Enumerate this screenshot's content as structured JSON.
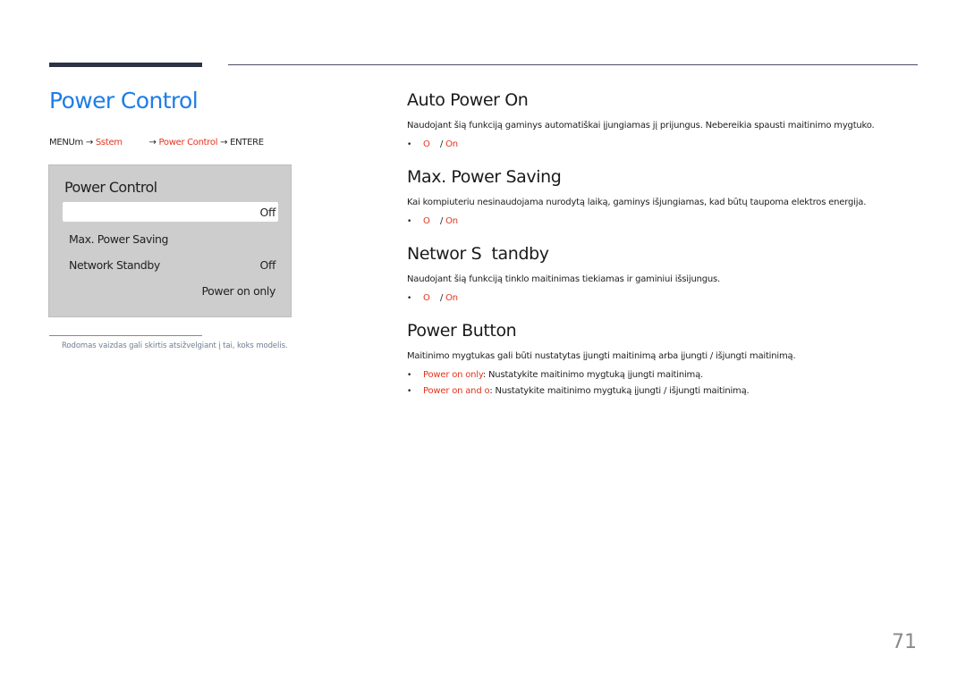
{
  "header": {
    "title": "Power Control",
    "breadcrumb": {
      "menu": "MENUm",
      "arrow": "→",
      "system": "Sstem",
      "section": "Power Control",
      "enter": "ENTERE"
    }
  },
  "osd_panel": {
    "title": "Power Control",
    "rows": [
      {
        "label": "",
        "value": "Off",
        "selected": true
      },
      {
        "label": "Max. Power Saving",
        "value": ""
      },
      {
        "label": "Network Standby",
        "value": "Off"
      },
      {
        "label": "",
        "value": "Power on only"
      }
    ]
  },
  "footnote": "Rodomas vaizdas gali skirtis atsižvelgiant į tai, koks modelis.",
  "sections": [
    {
      "heading": "Auto Power On",
      "description": "Naudojant šią funkciją gaminys automatiškai įjungiamas jį prijungus. Nebereikia spausti maitinimo mygtuko.",
      "options": {
        "off": "O",
        "separator": "/",
        "on": "On"
      }
    },
    {
      "heading": "Max. Power Saving",
      "description": "Kai kompiuteriu nesinaudojama nurodytą laiką, gaminys išjungiamas, kad būtų taupoma elektros energija.",
      "options": {
        "off": "O",
        "separator": "/",
        "on": "On"
      }
    },
    {
      "heading": "Networ S  tandby",
      "description": "Naudojant šią funkciją tinklo maitinimas tiekiamas ir gaminiui išsijungus.",
      "options": {
        "off": "O",
        "separator": "/",
        "on": "On"
      }
    },
    {
      "heading": "Power Button",
      "description": "Maitinimo mygtukas gali būti nustatytas įjungti maitinimą arba įjungti / išjungti maitinimą.",
      "items": [
        {
          "term": "Power on only",
          "text": ": Nustatykite maitinimo mygtuką įjungti maitinimą."
        },
        {
          "term": "Power on and o",
          "text": ": Nustatykite maitinimo mygtuką įjungti / išjungti maitinimą."
        }
      ]
    }
  ],
  "bullet": "•",
  "page_number": "71",
  "colors": {
    "title_blue": "#1e7de6",
    "accent_red": "#e2351f",
    "panel_gray": "#cdcdcd",
    "rule_dark": "#2b3345"
  }
}
